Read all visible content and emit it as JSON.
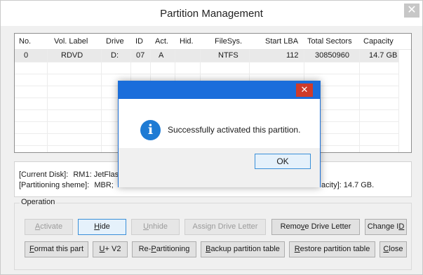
{
  "window": {
    "title": "Partition Management",
    "close_glyph": "✕"
  },
  "table": {
    "headers": [
      "No.",
      "Vol. Label",
      "Drive",
      "ID",
      "Act.",
      "Hid.",
      "FileSys.",
      "Start LBA",
      "Total Sectors",
      "Capacity"
    ],
    "rows": [
      [
        "0",
        "RDVD",
        "D:",
        "07",
        "A",
        "",
        "NTFS",
        "112",
        "30850960",
        "14.7 GB"
      ]
    ]
  },
  "info": {
    "current_disk_label": "[Current Disk]:",
    "current_disk_value": "RM1: JetFlas",
    "scheme_label": "[Partitioning sheme]:",
    "scheme_value": "MBR;",
    "capacity_text": "acity]: 14.7 GB."
  },
  "operation": {
    "legend": "Operation",
    "buttons_row1": [
      {
        "key": "A",
        "rest": "ctivate",
        "pre": ""
      },
      {
        "key": "H",
        "rest": "ide",
        "pre": ""
      },
      {
        "key": "U",
        "rest": "nhide",
        "pre": ""
      },
      {
        "key": "",
        "rest": "",
        "pre": "Assign Drive Letter"
      },
      {
        "key": "v",
        "rest": "e Drive Letter",
        "pre": "Remo"
      },
      {
        "key": "D",
        "rest": "",
        "pre": "Change I"
      }
    ],
    "buttons_row2": [
      {
        "key": "F",
        "rest": "ormat this part",
        "pre": ""
      },
      {
        "key": "U",
        "rest": "+ V2",
        "pre": ""
      },
      {
        "key": "P",
        "rest": "artitioning",
        "pre": "Re-"
      },
      {
        "key": "B",
        "rest": "ackup partition table",
        "pre": ""
      },
      {
        "key": "R",
        "rest": "estore partition table",
        "pre": ""
      },
      {
        "key": "C",
        "rest": "lose",
        "pre": ""
      }
    ]
  },
  "dialog": {
    "message": "Successfully activated this partition.",
    "ok_label": "OK",
    "close_glyph": "✕",
    "icon_glyph": "i"
  },
  "colors": {
    "dialog_titlebar": "#1a6ddb",
    "dialog_close": "#cf3b2a",
    "info_icon": "#1e7bd4"
  }
}
